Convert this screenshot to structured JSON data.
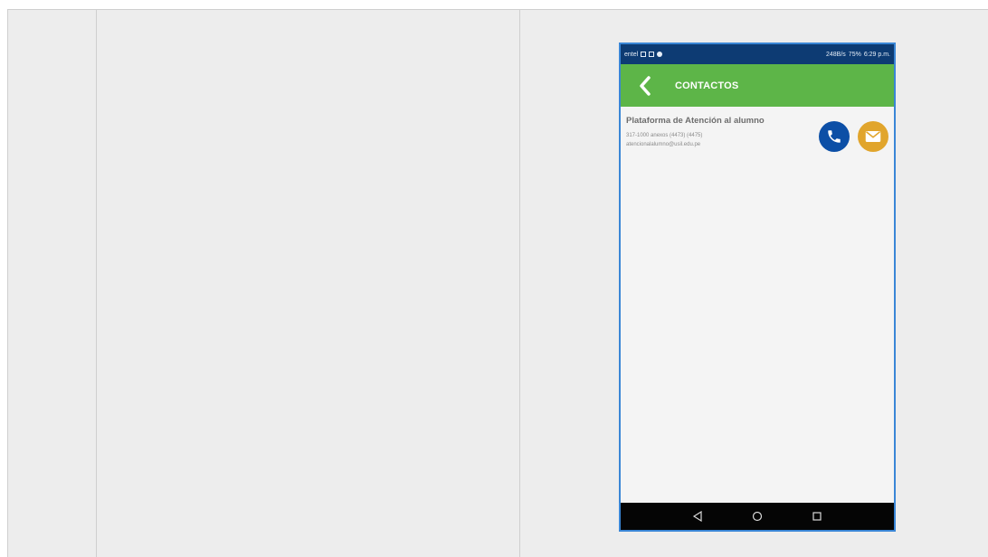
{
  "status_bar": {
    "left_text": "entel",
    "right_text": "248B/s",
    "battery_percent": "75%",
    "time": "6:29 p.m."
  },
  "app_bar": {
    "title": "CONTACTOS",
    "background": "#5db548"
  },
  "contact": {
    "name": "Plataforma de Atención al alumno",
    "phone": "317-1000 anexos (4473) (4475)",
    "email": "atencionalalumno@usil.edu.pe",
    "call_icon": "phone-icon",
    "mail_icon": "mail-icon",
    "call_color": "#0c4fa6",
    "mail_color": "#e1a52c"
  },
  "nav_bar": {
    "icons": [
      "back-triangle-icon",
      "home-circle-icon",
      "recents-square-icon"
    ]
  }
}
